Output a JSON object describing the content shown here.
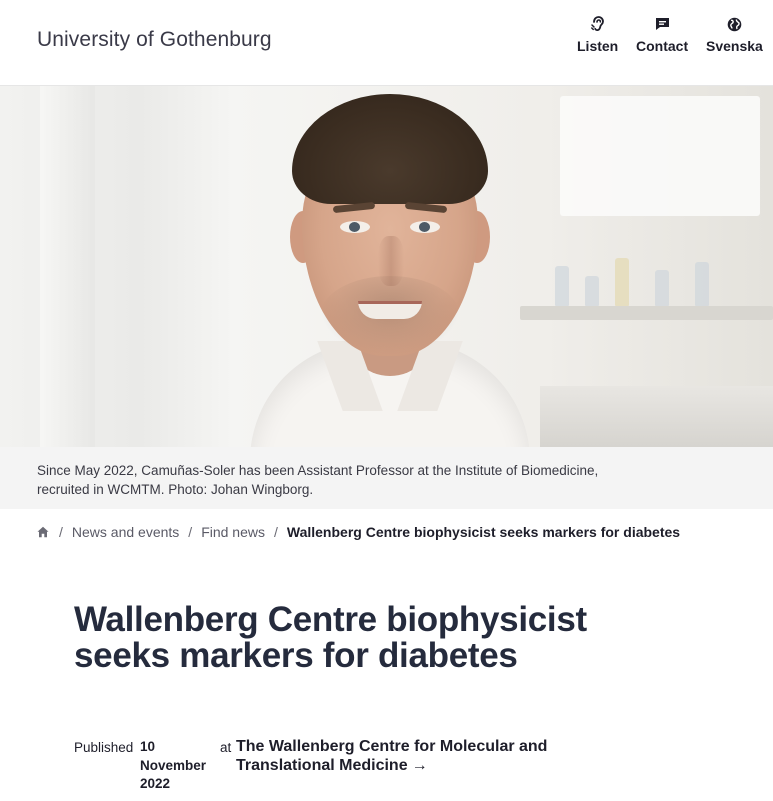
{
  "header": {
    "logo": "University of Gothenburg",
    "utility_nav": [
      {
        "label": "Listen",
        "icon": "ear-icon"
      },
      {
        "label": "Contact",
        "icon": "chat-icon"
      },
      {
        "label": "Svenska",
        "icon": "globe-icon"
      }
    ]
  },
  "hero": {
    "caption": "Since May 2022, Camuñas-Soler has been Assistant Professor at the Institute of Biomedicine, recruited in WCMTM. Photo: Johan Wingborg."
  },
  "breadcrumb": {
    "home_icon": "home-icon",
    "separator": "/",
    "items": [
      "News and events",
      "Find news"
    ],
    "current": "Wallenberg Centre biophysicist seeks markers for diabetes"
  },
  "article": {
    "title": "Wallenberg Centre biophysicist seeks markers for diabetes",
    "published_label": "Published",
    "published_date": "10 November 2022",
    "at_label": "at",
    "organization": "The Wallenberg Centre for Molecular and Translational Medicine",
    "organization_arrow": "→"
  },
  "colors": {
    "text_dark": "#1e1e2a",
    "title": "#252b3d",
    "caption_bg": "#f4f4f4"
  }
}
